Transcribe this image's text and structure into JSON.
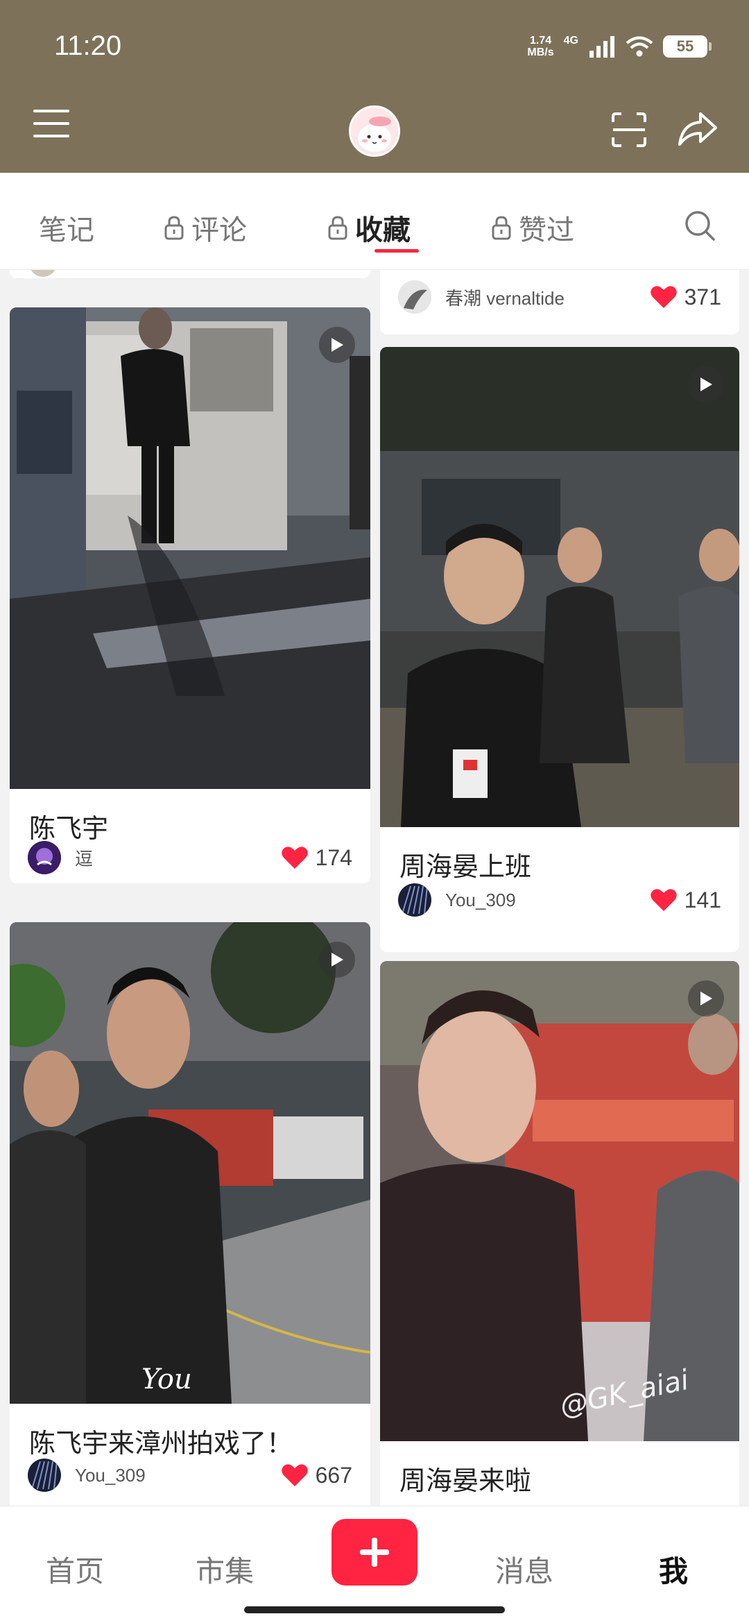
{
  "status_bar": {
    "time": "11:20",
    "net_speed_value": "1.74",
    "net_speed_unit": "MB/s",
    "network": "4G",
    "battery": "55"
  },
  "profile_tabs": [
    {
      "label": "笔记",
      "locked": false,
      "active": false
    },
    {
      "label": "评论",
      "locked": true,
      "active": false
    },
    {
      "label": "收藏",
      "locked": true,
      "active": true
    },
    {
      "label": "赞过",
      "locked": true,
      "active": false
    }
  ],
  "feed": {
    "top_right_partial": {
      "author": "春潮 vernaltide",
      "likes": "371"
    },
    "cards": [
      {
        "title": "陈飞宇",
        "author": "逗",
        "likes": "174",
        "video": true
      },
      {
        "title": "周海晏上班",
        "author": "You_309",
        "likes": "141",
        "video": true
      },
      {
        "title": "陈飞宇来漳州拍戏了！",
        "author": "You_309",
        "likes": "667",
        "video": true,
        "watermark": "You"
      },
      {
        "title": "周海晏来啦",
        "author": "",
        "likes": "",
        "video": true,
        "watermark": "@GK_aiai"
      }
    ]
  },
  "bottom_nav": {
    "home": "首页",
    "market": "市集",
    "messages": "消息",
    "me": "我"
  },
  "colors": {
    "header_bg": "#7d7259",
    "accent": "#ff2442"
  },
  "icons": [
    "menu-icon",
    "scan-icon",
    "share-icon",
    "lock-icon",
    "search-icon",
    "heart-icon",
    "play-icon",
    "plus-icon"
  ]
}
